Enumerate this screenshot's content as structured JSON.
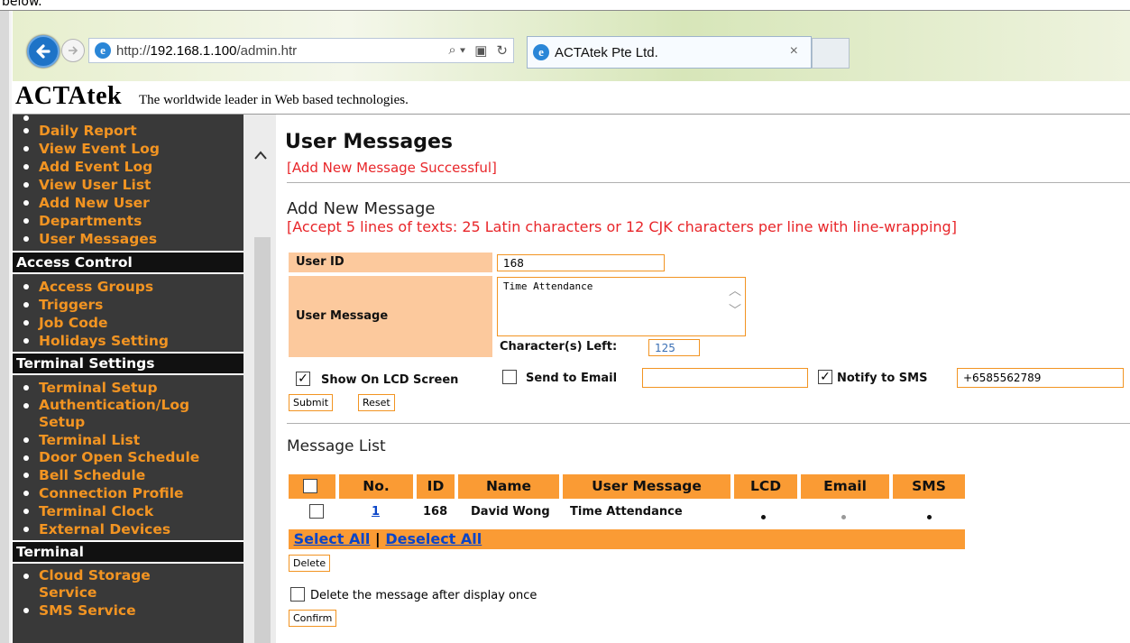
{
  "browser": {
    "url_prefix": "http://",
    "url_host": "192.168.1.100",
    "url_path": "/admin.htr",
    "tab_title": "ACTAtek Pte Ltd.",
    "tab_close": "×",
    "search_glyph": "⌕ ▾",
    "compat_glyph": "▣",
    "refresh_glyph": "↻",
    "top_cut_text": "below."
  },
  "header": {
    "brand": "ACTAtek",
    "tagline": "The worldwide leader in Web based technologies."
  },
  "sidebar": {
    "group1": [
      "Daily Report",
      "View Event Log",
      "Add Event Log",
      "View User List",
      "Add New User",
      "Departments",
      "User Messages"
    ],
    "section_access": "Access Control",
    "group2": [
      "Access Groups",
      "Triggers",
      "Job Code",
      "Holidays Setting"
    ],
    "section_terminal_settings": "Terminal Settings",
    "group3": [
      "Terminal Setup",
      "Authentication/Log Setup",
      "Terminal List",
      "Door Open Schedule",
      "Bell Schedule",
      "Connection Profile",
      "Terminal Clock",
      "External Devices"
    ],
    "section_terminal": "Terminal",
    "group4": [
      "Cloud Storage Service",
      "SMS Service"
    ]
  },
  "main": {
    "title": "User Messages",
    "success": "[Add New Message Successful]",
    "add_title": "Add New Message",
    "accept_note": "[Accept 5 lines of texts: 25 Latin characters or 12 CJK characters per line with line-wrapping]",
    "user_id_label": "User ID",
    "user_id_value": "168",
    "user_message_label": "User Message",
    "user_message_value": "Time Attendance",
    "chars_left_label": "Character(s) Left:",
    "chars_left_value": "125",
    "show_lcd_label": "Show On LCD Screen",
    "send_email_label": "Send to Email",
    "email_value": "",
    "notify_sms_label": "Notify to SMS",
    "sms_value": "+6585562789",
    "submit": "Submit",
    "reset": "Reset",
    "list_title": "Message List",
    "columns": [
      "No.",
      "ID",
      "Name",
      "User Message",
      "LCD",
      "Email",
      "SMS"
    ],
    "rows": [
      {
        "no": "1",
        "id": "168",
        "name": "David Wong",
        "message": "Time Attendance",
        "lcd": true,
        "email": false,
        "sms": true
      }
    ],
    "select_all": "Select All",
    "separator": "|",
    "deselect_all": "Deselect All",
    "delete": "Delete",
    "delete_after_label": "Delete the message after display once",
    "confirm": "Confirm"
  }
}
